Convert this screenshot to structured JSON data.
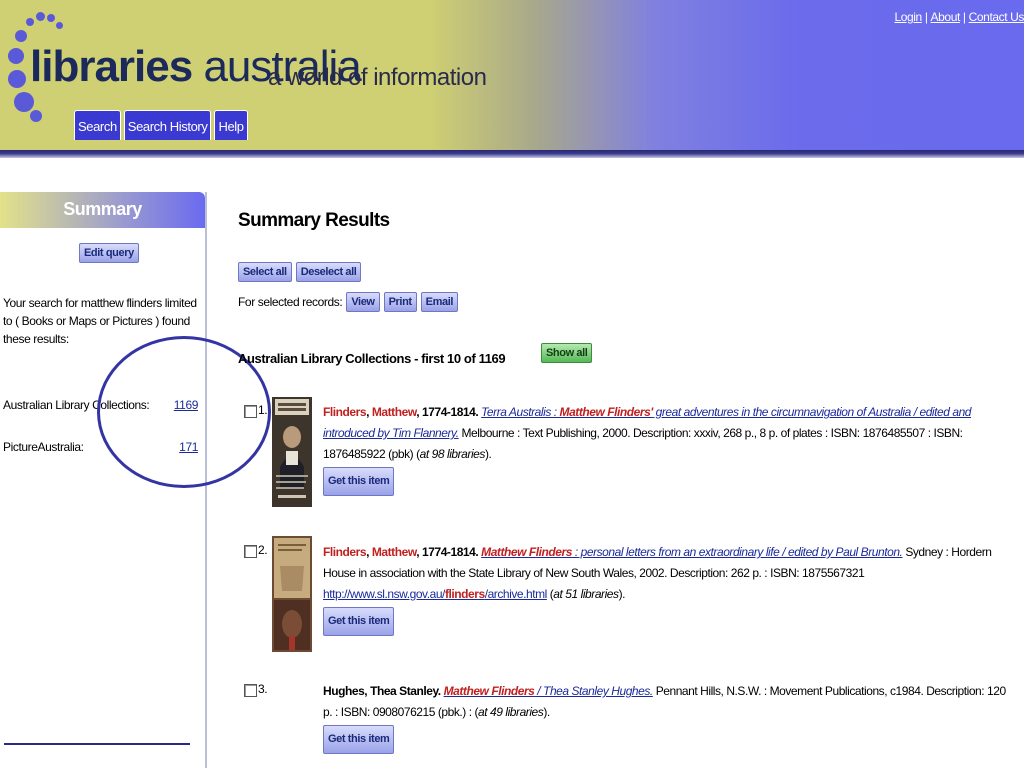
{
  "header": {
    "logo_bold": "libraries",
    "logo_light": " australia",
    "tagline": "a world of information",
    "tabs": [
      "Search",
      "Search History",
      "Help"
    ],
    "top_links": [
      "Login",
      "About",
      "Contact Us"
    ]
  },
  "sidebar": {
    "title": "Summary",
    "edit_query": "Edit query",
    "description": "Your search for matthew flinders limited to ( Books or Maps or Pictures ) found these results:",
    "rows": [
      {
        "label": "Australian Library Collections:",
        "count": "1169"
      },
      {
        "label": "PictureAustralia:",
        "count": "171"
      }
    ]
  },
  "main": {
    "title": "Summary Results",
    "select_all": "Select all",
    "deselect_all": "Deselect all",
    "for_selected": "For selected records:",
    "actions": [
      "View",
      "Print",
      "Email"
    ],
    "collection_heading": "Australian Library Collections - first 10 of 1169",
    "show_all": "Show all",
    "get_item": "Get this item",
    "results": [
      {
        "num": "1.",
        "author_surname": "Flinders",
        "author_first": "Matthew",
        "author_dates": ", 1774-1814.",
        "title_pre": "Terra Australis : ",
        "title_hl": "Matthew Flinders'",
        "title_post": " great adventures in the circumnavigation of Australia / edited and introduced by Tim Flannery.",
        "pub": "Melbourne : Text Publishing, 2000. Description: xxxiv, 268 p., 8 p. of plates : ISBN: 1876485507 : ISBN: 1876485922 (pbk)",
        "held": "at 98 libraries"
      },
      {
        "num": "2.",
        "author_surname": "Flinders",
        "author_first": "Matthew",
        "author_dates": ", 1774-1814.",
        "title_hl": "Matthew Flinders",
        "title_post": " : personal letters from an extraordinary life / edited by Paul Brunton.",
        "pub": "Sydney : Hordern House in association with the State Library of New South Wales, 2002. Description: 262 p. : ISBN: 1875567321",
        "url_pre": "http://www.sl.nsw.gov.au/",
        "url_hl": "flinders",
        "url_post": "/archive.html",
        "held": "at 51 libraries"
      },
      {
        "num": "3.",
        "author": "Hughes, Thea Stanley.",
        "title_hl": "Matthew Flinders",
        "title_post": " / Thea Stanley Hughes.",
        "pub": "Pennant Hills, N.S.W. : Movement Publications, c1984. Description: 120 p. : ISBN: 0908076215 (pbk.) :",
        "held": "at 49 libraries"
      }
    ]
  },
  "colors": {
    "header_left": "#cfcf73",
    "header_right": "#6a6aee",
    "tab_bg": "#3a3ad2",
    "highlight_red": "#c02020",
    "link_blue": "#1a2a9a",
    "annotation_circle": "#3434a4"
  }
}
